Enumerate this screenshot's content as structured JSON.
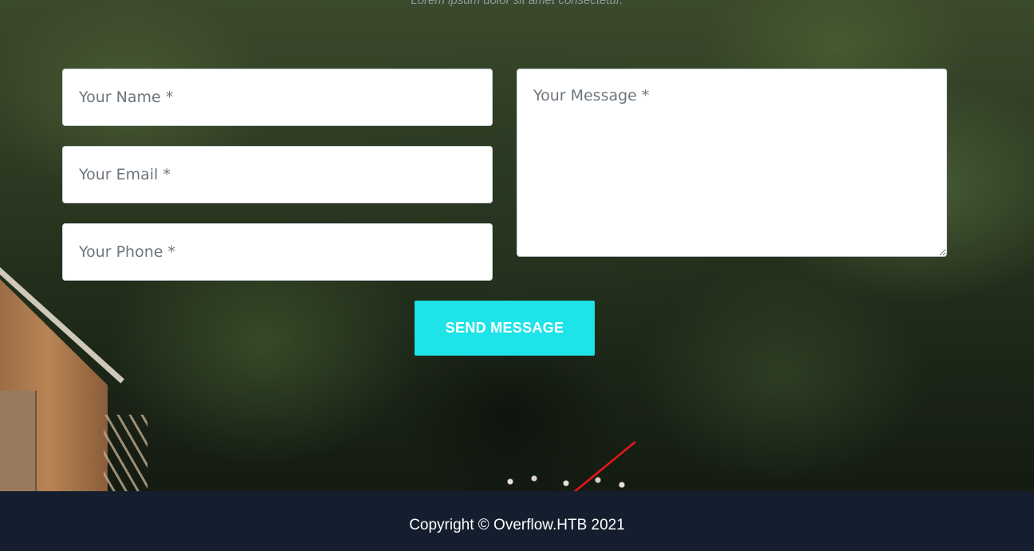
{
  "section": {
    "subtitle": "Lorem ipsum dolor sit amet consectetur."
  },
  "form": {
    "name_placeholder": "Your Name *",
    "email_placeholder": "Your Email *",
    "phone_placeholder": "Your Phone *",
    "message_placeholder": "Your Message *",
    "submit_label": "SEND MESSAGE"
  },
  "colors": {
    "accent": "#1ee3e9",
    "footer_bg": "#151e2e",
    "annotation_arrow": "#e8161b"
  },
  "footer": {
    "copyright": "Copyright © Overflow.HTB 2021"
  }
}
